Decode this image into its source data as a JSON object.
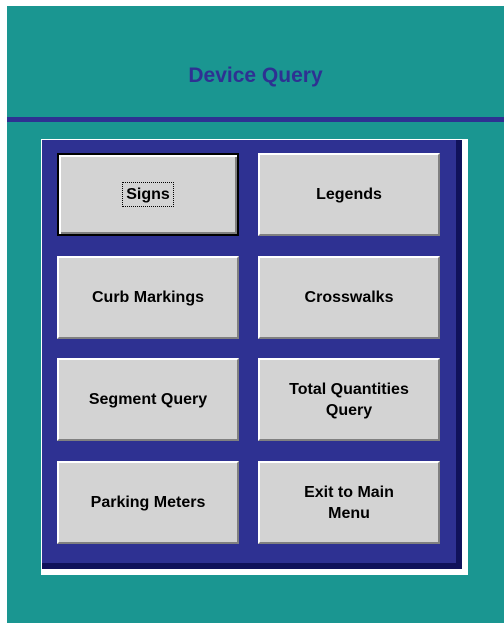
{
  "form": {
    "title": "Device Query"
  },
  "buttons": {
    "signs": "Signs",
    "legends": "Legends",
    "curb_markings": "Curb Markings",
    "crosswalks": "Crosswalks",
    "segment_query": "Segment Query",
    "total_quantities_query": "Total Quantities\nQuery",
    "parking_meters": "Parking Meters",
    "exit_to_main_menu": "Exit to Main\nMenu"
  },
  "colors": {
    "form_background": "#1a9691",
    "title_text": "#2e3192",
    "panel_background": "#2e3192",
    "button_face": "#d3d3d3"
  }
}
